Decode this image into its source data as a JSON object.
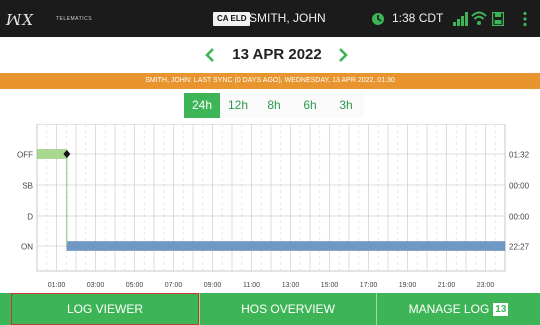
{
  "statusbar": {
    "logo_text": "ꟽX",
    "logo_subtext": "TELEMATICS",
    "eld_badge": "CA ELD",
    "driver_name": "SMITH, JOHN",
    "time": "1:38 CDT",
    "icons": [
      "clock-icon",
      "signal-icon",
      "wifi-icon",
      "save-icon",
      "menu-icon"
    ]
  },
  "datenav": {
    "prev_symbol": "‹",
    "date": "13 APR 2022",
    "next_symbol": "›"
  },
  "sync_banner": "SMITH, JOHN: LAST SYNC (0 DAYS AGO), WEDNESDAY, 13 APR 2022, 01:30",
  "range_tabs": [
    {
      "label": "24h",
      "active": true
    },
    {
      "label": "12h",
      "active": false
    },
    {
      "label": "8h",
      "active": false
    },
    {
      "label": "6h",
      "active": false
    },
    {
      "label": "3h",
      "active": false
    }
  ],
  "chart_data": {
    "type": "line",
    "title": "",
    "x_unit": "hours",
    "xlim": [
      0,
      24
    ],
    "x_ticks": [
      "01:00",
      "03:00",
      "05:00",
      "07:00",
      "09:00",
      "11:00",
      "13:00",
      "15:00",
      "17:00",
      "19:00",
      "21:00",
      "23:00"
    ],
    "statuses": [
      "OFF",
      "SB",
      "D",
      "ON"
    ],
    "totals": {
      "OFF": "01:32",
      "SB": "00:00",
      "D": "00:00",
      "ON": "22:27"
    },
    "segments": [
      {
        "status": "OFF",
        "start": 0.0,
        "end": 1.53
      },
      {
        "status": "ON",
        "start": 1.53,
        "end": 24.0
      }
    ],
    "marker": {
      "status": "OFF",
      "x": 1.53
    },
    "colors": {
      "OFF": "#a8d890",
      "ON": "#6f98c5"
    },
    "grid": true
  },
  "bottom_nav": {
    "log_viewer": "LOG VIEWER",
    "hos_overview": "HOS OVERVIEW",
    "manage_log": "MANAGE LOG",
    "manage_count": "13"
  }
}
